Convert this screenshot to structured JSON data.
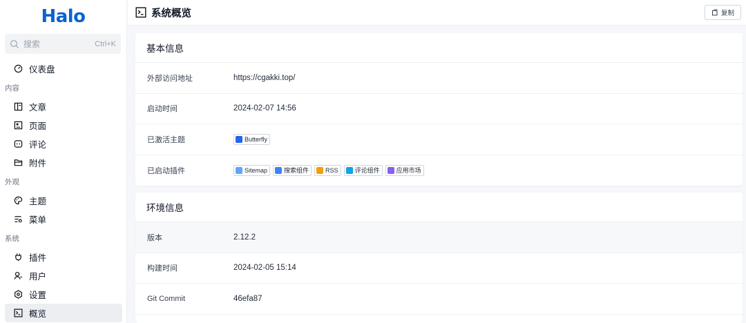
{
  "app": {
    "logo_text": "Halo"
  },
  "search": {
    "placeholder": "搜索",
    "shortcut": "Ctrl+K"
  },
  "sidebar": {
    "dashboard": "仪表盘",
    "groups": [
      {
        "label": "内容",
        "items": [
          {
            "label": "文章",
            "icon": "article-icon"
          },
          {
            "label": "页面",
            "icon": "page-icon"
          },
          {
            "label": "评论",
            "icon": "comment-icon"
          },
          {
            "label": "附件",
            "icon": "folder-icon"
          }
        ]
      },
      {
        "label": "外观",
        "items": [
          {
            "label": "主题",
            "icon": "palette-icon"
          },
          {
            "label": "菜单",
            "icon": "menu-icon"
          }
        ]
      },
      {
        "label": "系统",
        "items": [
          {
            "label": "插件",
            "icon": "plug-icon"
          },
          {
            "label": "用户",
            "icon": "user-icon"
          },
          {
            "label": "设置",
            "icon": "settings-icon"
          },
          {
            "label": "概览",
            "icon": "terminal-icon"
          }
        ]
      }
    ]
  },
  "header": {
    "title": "系统概览",
    "copy_label": "复制"
  },
  "basic": {
    "title": "基本信息",
    "rows": [
      {
        "key": "外部访问地址",
        "value": "https://cgakki.top/"
      },
      {
        "key": "启动时间",
        "value": "2024-02-07 14:56"
      },
      {
        "key": "已激活主题"
      },
      {
        "key": "已启动插件"
      }
    ],
    "theme_tag": {
      "label": "Butterfly",
      "color": "#2563eb"
    },
    "plugin_tags": [
      {
        "label": "Sitemap",
        "color": "#60a5fa"
      },
      {
        "label": "搜索组件",
        "color": "#3b82f6"
      },
      {
        "label": "RSS",
        "color": "#f59e0b"
      },
      {
        "label": "评论组件",
        "color": "#0ea5e9"
      },
      {
        "label": "应用市场",
        "color": "#8b5cf6"
      }
    ]
  },
  "env": {
    "title": "环境信息",
    "rows": [
      {
        "key": "版本",
        "value": "2.12.2"
      },
      {
        "key": "构建时间",
        "value": "2024-02-05 15:14"
      },
      {
        "key": "Git Commit",
        "value": "46efa87"
      }
    ]
  },
  "colors": {
    "brand": "#0b63ce",
    "active_bg": "#eceef2"
  }
}
